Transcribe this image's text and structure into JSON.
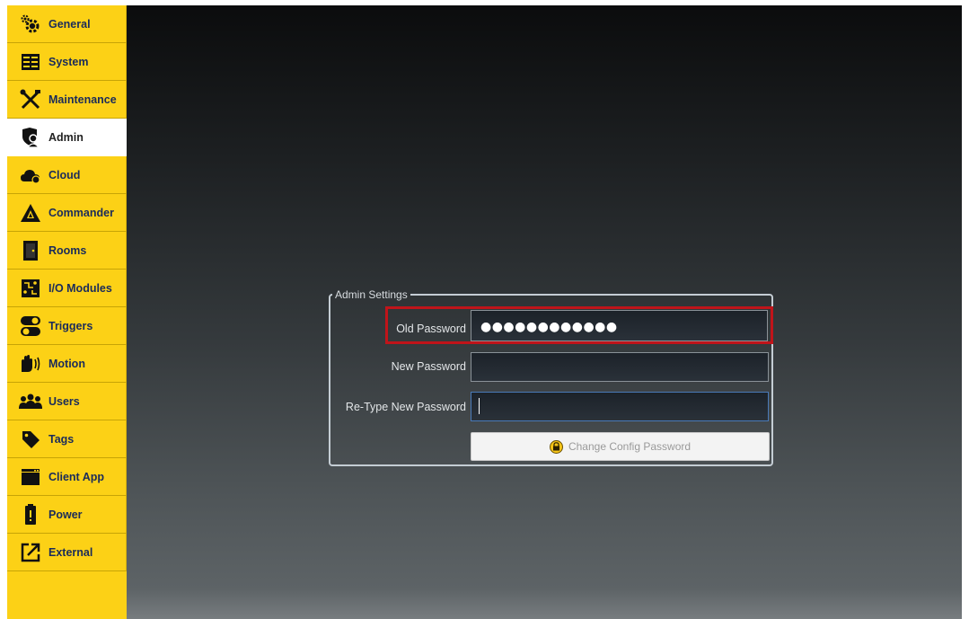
{
  "sidebar": {
    "items": [
      {
        "label": "General",
        "icon": "gears-icon"
      },
      {
        "label": "System",
        "icon": "server-icon"
      },
      {
        "label": "Maintenance",
        "icon": "tools-icon"
      },
      {
        "label": "Admin",
        "icon": "admin-shield-icon",
        "active": true
      },
      {
        "label": "Cloud",
        "icon": "cloud-icon"
      },
      {
        "label": "Commander",
        "icon": "commander-logo-icon"
      },
      {
        "label": "Rooms",
        "icon": "door-icon"
      },
      {
        "label": "I/O Modules",
        "icon": "io-module-icon"
      },
      {
        "label": "Triggers",
        "icon": "toggle-switch-icon"
      },
      {
        "label": "Motion",
        "icon": "motion-hand-icon"
      },
      {
        "label": "Users",
        "icon": "users-icon"
      },
      {
        "label": "Tags",
        "icon": "tag-icon"
      },
      {
        "label": "Client App",
        "icon": "app-window-icon"
      },
      {
        "label": "Power",
        "icon": "battery-icon"
      },
      {
        "label": "External",
        "icon": "external-link-icon"
      }
    ]
  },
  "admin_settings": {
    "legend": "Admin Settings",
    "old_password_label": "Old Password",
    "old_password_value": "●●●●●●●●●●●●",
    "new_password_label": "New Password",
    "new_password_value": "",
    "retype_password_label": "Re-Type New Password",
    "retype_password_value": "",
    "change_button_label": "Change Config Password"
  },
  "colors": {
    "sidebar_bg": "#fcd116",
    "highlight": "#c0141a",
    "nav_text": "#1a2b5a"
  }
}
